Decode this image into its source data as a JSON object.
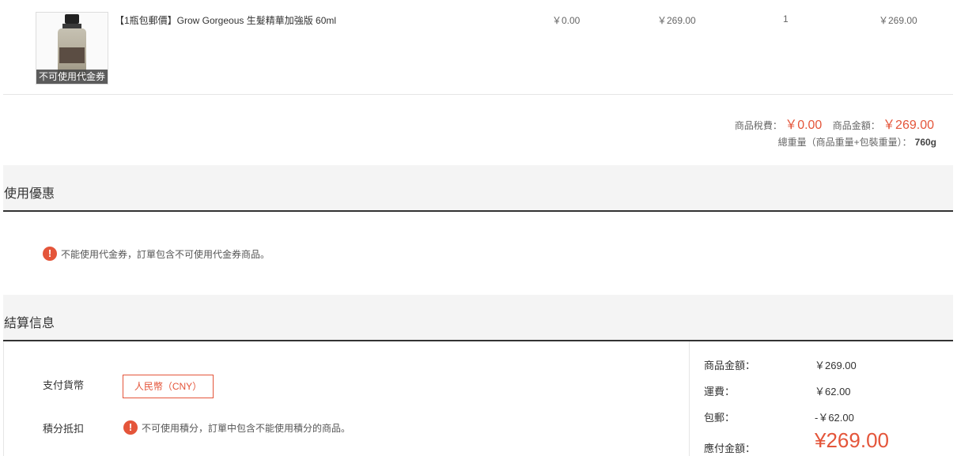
{
  "product": {
    "badge": "不可使用代金券",
    "title": "【1瓶包郵價】Grow Gorgeous 生髮精華加強版 60ml",
    "tax": "￥0.00",
    "unit_price": "￥269.00",
    "qty": "1",
    "subtotal": "￥269.00"
  },
  "summary": {
    "tax_label": "商品稅費：",
    "tax_value": "￥0.00",
    "amount_label": "商品金額：",
    "amount_value": "￥269.00",
    "weight_label": "總重量（商品重量+包裝重量）：",
    "weight_value": "760g"
  },
  "discount_section": {
    "title": "使用優惠",
    "warning": "不能使用代金券，訂單包含不可使用代金券商品。"
  },
  "settlement_section": {
    "title": "結算信息",
    "currency_label": "支付貨幣",
    "currency_value": "人民幣（CNY）",
    "points_label": "積分抵扣",
    "points_warning": "不可使用積分，訂單中包含不能使用積分的商品。"
  },
  "totals": {
    "goods_label": "商品金額：",
    "goods_value": "￥269.00",
    "shipping_label": "運費：",
    "shipping_value": "￥62.00",
    "free_ship_label": "包郵：",
    "free_ship_value": "-￥62.00",
    "payable_label": "應付金額：",
    "payable_value": "¥269.00"
  },
  "colors": {
    "accent": "#e4553a",
    "header_bg": "#f4f4f4"
  },
  "icons": {
    "warning": "exclamation-circle-icon"
  }
}
